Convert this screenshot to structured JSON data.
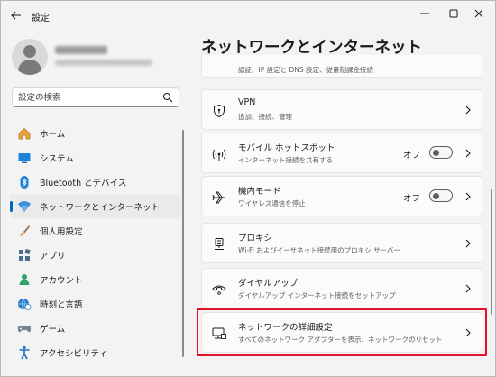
{
  "window": {
    "title": "設定"
  },
  "search": {
    "placeholder": "設定の検索"
  },
  "sidebar": {
    "items": [
      {
        "label": "ホーム",
        "icon": "home-icon"
      },
      {
        "label": "システム",
        "icon": "system-icon"
      },
      {
        "label": "Bluetooth とデバイス",
        "icon": "bluetooth-icon"
      },
      {
        "label": "ネットワークとインターネット",
        "icon": "network-icon",
        "active": true
      },
      {
        "label": "個人用設定",
        "icon": "brush-icon"
      },
      {
        "label": "アプリ",
        "icon": "apps-icon"
      },
      {
        "label": "アカウント",
        "icon": "account-icon"
      },
      {
        "label": "時刻と言語",
        "icon": "globe-clock-icon"
      },
      {
        "label": "ゲーム",
        "icon": "gamepad-icon"
      },
      {
        "label": "アクセシビリティ",
        "icon": "accessibility-icon"
      }
    ]
  },
  "main": {
    "title": "ネットワークとインターネット",
    "cards": [
      {
        "title": "",
        "desc": "認証、IP 設定と DNS 設定、従量制課金接続",
        "icon": "ethernet-icon"
      },
      {
        "title": "VPN",
        "desc": "追加、接続、管理",
        "icon": "vpn-shield-icon"
      },
      {
        "title": "モバイル ホットスポット",
        "desc": "インターネット接続を共有する",
        "icon": "hotspot-icon",
        "toggle": "オフ"
      },
      {
        "title": "機内モード",
        "desc": "ワイヤレス通信を停止",
        "icon": "airplane-icon",
        "toggle": "オフ"
      },
      {
        "title": "プロキシ",
        "desc": "Wi-Fi およびイーサネット接続用のプロキシ サーバー",
        "icon": "proxy-icon"
      },
      {
        "title": "ダイヤルアップ",
        "desc": "ダイヤルアップ インターネット接続をセットアップ",
        "icon": "dialup-icon"
      },
      {
        "title": "ネットワークの詳細設定",
        "desc": "すべてのネットワーク アダプターを表示、ネットワークのリセット",
        "icon": "advanced-network-icon"
      }
    ]
  },
  "colors": {
    "accent": "#0067c0",
    "highlight": "#e0142a",
    "background": "#f3f3f3"
  }
}
